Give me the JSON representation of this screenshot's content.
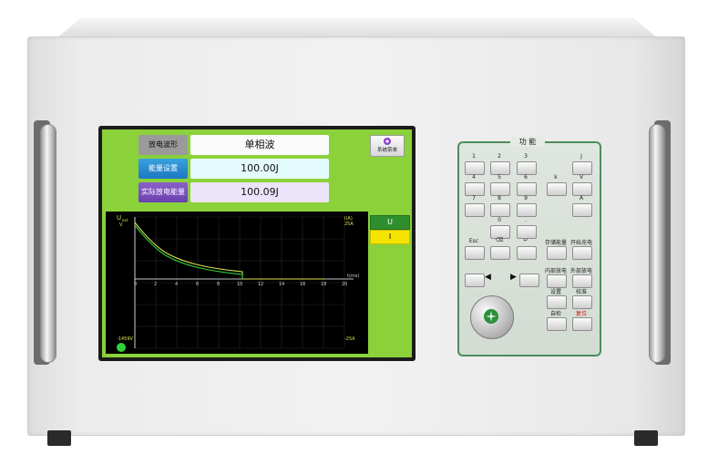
{
  "screen": {
    "waveform_label": "放电波形",
    "waveform_value": "单相波",
    "energy_set_label": "能量设置",
    "energy_set_value": "100.00J",
    "actual_energy_label": "实际放电能量",
    "actual_energy_value": "100.09J",
    "system_menu": "系统菜单",
    "u_button": "U",
    "i_button": "I"
  },
  "oscilloscope": {
    "u_axis_label": "U",
    "u_axis_sub": "ext",
    "u_axis_unit": "V",
    "i_axis_label": "I(A)",
    "i_top_value": "25A",
    "i_bottom_value": "-25A",
    "u_bottom_value": "-1459V",
    "x_unit": "t(ms)",
    "x_ticks": [
      "0",
      "2",
      "4",
      "6",
      "8",
      "10",
      "12",
      "14",
      "16",
      "18",
      "20"
    ],
    "colors": {
      "voltage": "#d8e04a",
      "current": "#2fd13a",
      "grid": "#2a2a2a"
    }
  },
  "keypad": {
    "title": "功 能",
    "keys": [
      "1",
      "2",
      "3",
      "J",
      "4",
      "5",
      "6",
      "k",
      "V",
      "7",
      "8",
      "9",
      "A",
      "0",
      ".",
      "Esc",
      "⌫",
      "↵",
      "存储能量",
      "开始充电",
      "◀",
      "▶",
      "内部放电",
      "外部放电",
      "设置",
      "校准",
      "自检",
      "复位"
    ]
  },
  "icons": {
    "menu": "flower-icon",
    "backspace": "backspace-icon",
    "enter": "enter-icon",
    "left": "left-arrow-icon",
    "right": "right-arrow-icon",
    "knob": "rotary-knob-icon"
  }
}
